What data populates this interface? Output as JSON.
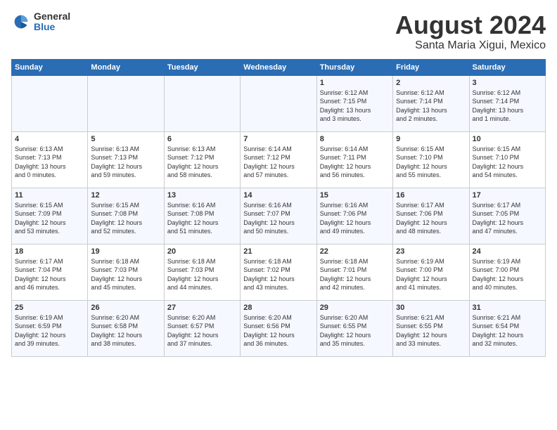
{
  "header": {
    "logo": {
      "general": "General",
      "blue": "Blue"
    },
    "title": "August 2024",
    "location": "Santa Maria Xigui, Mexico"
  },
  "weekdays": [
    "Sunday",
    "Monday",
    "Tuesday",
    "Wednesday",
    "Thursday",
    "Friday",
    "Saturday"
  ],
  "weeks": [
    [
      {
        "day": "",
        "info": ""
      },
      {
        "day": "",
        "info": ""
      },
      {
        "day": "",
        "info": ""
      },
      {
        "day": "",
        "info": ""
      },
      {
        "day": "1",
        "info": "Sunrise: 6:12 AM\nSunset: 7:15 PM\nDaylight: 13 hours\nand 3 minutes."
      },
      {
        "day": "2",
        "info": "Sunrise: 6:12 AM\nSunset: 7:14 PM\nDaylight: 13 hours\nand 2 minutes."
      },
      {
        "day": "3",
        "info": "Sunrise: 6:12 AM\nSunset: 7:14 PM\nDaylight: 13 hours\nand 1 minute."
      }
    ],
    [
      {
        "day": "4",
        "info": "Sunrise: 6:13 AM\nSunset: 7:13 PM\nDaylight: 13 hours\nand 0 minutes."
      },
      {
        "day": "5",
        "info": "Sunrise: 6:13 AM\nSunset: 7:13 PM\nDaylight: 12 hours\nand 59 minutes."
      },
      {
        "day": "6",
        "info": "Sunrise: 6:13 AM\nSunset: 7:12 PM\nDaylight: 12 hours\nand 58 minutes."
      },
      {
        "day": "7",
        "info": "Sunrise: 6:14 AM\nSunset: 7:12 PM\nDaylight: 12 hours\nand 57 minutes."
      },
      {
        "day": "8",
        "info": "Sunrise: 6:14 AM\nSunset: 7:11 PM\nDaylight: 12 hours\nand 56 minutes."
      },
      {
        "day": "9",
        "info": "Sunrise: 6:15 AM\nSunset: 7:10 PM\nDaylight: 12 hours\nand 55 minutes."
      },
      {
        "day": "10",
        "info": "Sunrise: 6:15 AM\nSunset: 7:10 PM\nDaylight: 12 hours\nand 54 minutes."
      }
    ],
    [
      {
        "day": "11",
        "info": "Sunrise: 6:15 AM\nSunset: 7:09 PM\nDaylight: 12 hours\nand 53 minutes."
      },
      {
        "day": "12",
        "info": "Sunrise: 6:15 AM\nSunset: 7:08 PM\nDaylight: 12 hours\nand 52 minutes."
      },
      {
        "day": "13",
        "info": "Sunrise: 6:16 AM\nSunset: 7:08 PM\nDaylight: 12 hours\nand 51 minutes."
      },
      {
        "day": "14",
        "info": "Sunrise: 6:16 AM\nSunset: 7:07 PM\nDaylight: 12 hours\nand 50 minutes."
      },
      {
        "day": "15",
        "info": "Sunrise: 6:16 AM\nSunset: 7:06 PM\nDaylight: 12 hours\nand 49 minutes."
      },
      {
        "day": "16",
        "info": "Sunrise: 6:17 AM\nSunset: 7:06 PM\nDaylight: 12 hours\nand 48 minutes."
      },
      {
        "day": "17",
        "info": "Sunrise: 6:17 AM\nSunset: 7:05 PM\nDaylight: 12 hours\nand 47 minutes."
      }
    ],
    [
      {
        "day": "18",
        "info": "Sunrise: 6:17 AM\nSunset: 7:04 PM\nDaylight: 12 hours\nand 46 minutes."
      },
      {
        "day": "19",
        "info": "Sunrise: 6:18 AM\nSunset: 7:03 PM\nDaylight: 12 hours\nand 45 minutes."
      },
      {
        "day": "20",
        "info": "Sunrise: 6:18 AM\nSunset: 7:03 PM\nDaylight: 12 hours\nand 44 minutes."
      },
      {
        "day": "21",
        "info": "Sunrise: 6:18 AM\nSunset: 7:02 PM\nDaylight: 12 hours\nand 43 minutes."
      },
      {
        "day": "22",
        "info": "Sunrise: 6:18 AM\nSunset: 7:01 PM\nDaylight: 12 hours\nand 42 minutes."
      },
      {
        "day": "23",
        "info": "Sunrise: 6:19 AM\nSunset: 7:00 PM\nDaylight: 12 hours\nand 41 minutes."
      },
      {
        "day": "24",
        "info": "Sunrise: 6:19 AM\nSunset: 7:00 PM\nDaylight: 12 hours\nand 40 minutes."
      }
    ],
    [
      {
        "day": "25",
        "info": "Sunrise: 6:19 AM\nSunset: 6:59 PM\nDaylight: 12 hours\nand 39 minutes."
      },
      {
        "day": "26",
        "info": "Sunrise: 6:20 AM\nSunset: 6:58 PM\nDaylight: 12 hours\nand 38 minutes."
      },
      {
        "day": "27",
        "info": "Sunrise: 6:20 AM\nSunset: 6:57 PM\nDaylight: 12 hours\nand 37 minutes."
      },
      {
        "day": "28",
        "info": "Sunrise: 6:20 AM\nSunset: 6:56 PM\nDaylight: 12 hours\nand 36 minutes."
      },
      {
        "day": "29",
        "info": "Sunrise: 6:20 AM\nSunset: 6:55 PM\nDaylight: 12 hours\nand 35 minutes."
      },
      {
        "day": "30",
        "info": "Sunrise: 6:21 AM\nSunset: 6:55 PM\nDaylight: 12 hours\nand 33 minutes."
      },
      {
        "day": "31",
        "info": "Sunrise: 6:21 AM\nSunset: 6:54 PM\nDaylight: 12 hours\nand 32 minutes."
      }
    ]
  ]
}
